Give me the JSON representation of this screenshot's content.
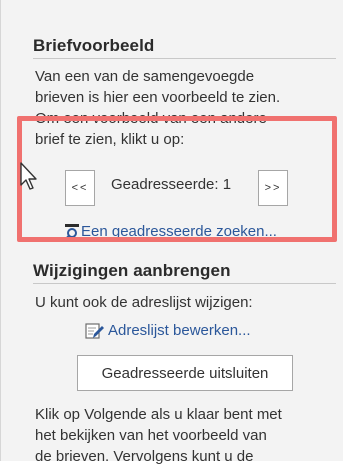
{
  "preview": {
    "title": "Briefvoorbeeld",
    "description_lines": [
      "Van een van de samengevoegde",
      "brieven is hier een voorbeeld te zien.",
      "Om een voorbeeld van een andere",
      "brief te zien, klikt u op:"
    ],
    "prev_label": "<<",
    "next_label": ">>",
    "recipient_label": "Geadresseerde: 1",
    "find_recipient_link": "Een geadresseerde zoeken..."
  },
  "changes": {
    "title": "Wijzigingen aanbrengen",
    "intro": "U kunt ook de adreslijst wijzigen:",
    "edit_list_link": "Adreslijst bewerken...",
    "exclude_button": "Geadresseerde uitsluiten",
    "footer_lines": [
      "Klik op Volgende als u klaar bent met",
      "het bekijken van het voorbeeld van",
      "de brieven. Vervolgens kunt u de"
    ]
  },
  "icons": {
    "find": "magnifier-icon",
    "edit": "edit-list-icon",
    "cursor": "mouse-pointer-icon"
  },
  "colors": {
    "panel_bg": "#f3f3f3",
    "link": "#2b579a",
    "highlight": "#f0716f"
  }
}
